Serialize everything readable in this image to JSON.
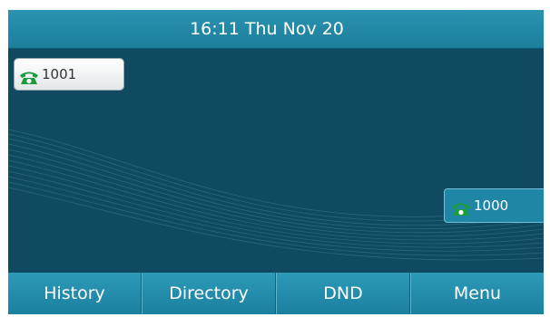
{
  "status_bar": {
    "time_date": "16:11 Thu Nov 20"
  },
  "line_keys": [
    {
      "label": "1001",
      "icon": "phone-icon",
      "color": "#1a9b3c"
    },
    {
      "label": "1000",
      "icon": "phone-icon",
      "color": "#1a9b3c"
    }
  ],
  "softkeys": [
    {
      "label": "History"
    },
    {
      "label": "Directory"
    },
    {
      "label": "DND"
    },
    {
      "label": "Menu"
    }
  ],
  "colors": {
    "screen_bg": "#0f4a60",
    "bar_accent": "#2a93b0",
    "phone_icon": "#1a9b3c"
  }
}
